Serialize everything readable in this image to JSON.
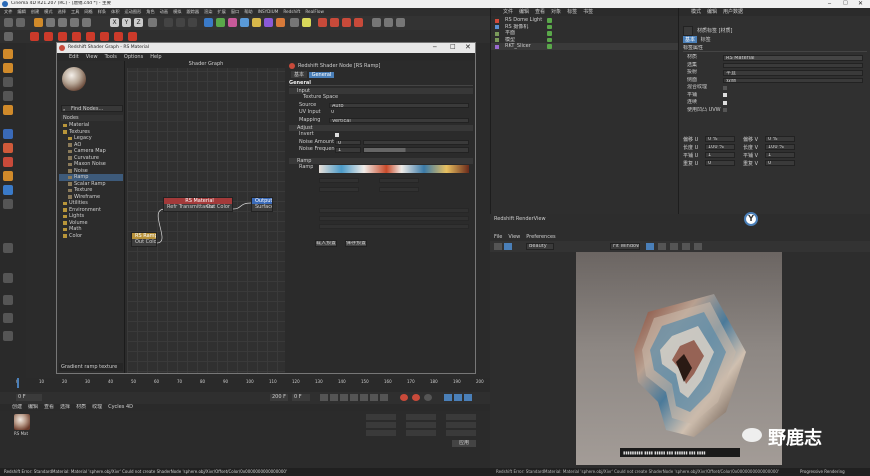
{
  "app_title": "Cinema 4D R21.207 (RC) - [唐锦.c4d *] - 主要",
  "main_menu": [
    "文件",
    "编辑",
    "创建",
    "模式",
    "选择",
    "工具",
    "网格",
    "样条",
    "体积",
    "运动图形",
    "角色",
    "动画",
    "模拟",
    "跟踪器",
    "渲染",
    "扩展",
    "窗口",
    "帮助",
    "INSYDIUM",
    "Redshift",
    "RealFlow"
  ],
  "shader_window": {
    "title": "Redshift Shader Graph - RS Material",
    "menu": [
      "Edit",
      "View",
      "Tools",
      "Options",
      "Help"
    ],
    "graph_title": "Shader Graph",
    "find_nodes": "Find Nodes...",
    "nodes_header": "Nodes",
    "tree": [
      "Material",
      "Textures",
      "Legacy",
      "AO",
      "Camera Map",
      "Curvature",
      "Maxon Noise",
      "Noise",
      "Ramp",
      "Scalar Ramp",
      "Texture",
      "Wireframe",
      "Utilities",
      "Environment",
      "Lights",
      "Volume",
      "Math",
      "Color"
    ],
    "description": "Gradient ramp texture",
    "nodes": {
      "rs_material": {
        "title": "RS Material",
        "in": "Refr Transmittance",
        "out": "Out Color"
      },
      "output": {
        "title": "Output",
        "in": "Surface"
      },
      "rs_ramp": {
        "title": "RS Ramp",
        "out": "Out Color"
      }
    },
    "props": {
      "node_title": "Redshift Shader Node [RS Ramp]",
      "tabs": [
        "基本",
        "General"
      ],
      "section_general": "General",
      "input_label": "Input",
      "texture_space": "Texture Space",
      "source_label": "Source",
      "source_value": "Auto",
      "uv_input_label": "UV Input",
      "uv_input_value": "0",
      "mapping_label": "Mapping",
      "mapping_value": "Vertical",
      "adjust_label": "Adjust",
      "invert_label": "Invert",
      "noise_amount_label": "Noise Amount",
      "noise_amount_value": "0",
      "noise_freq_label": "Noise Frequency",
      "noise_freq_value": "1",
      "ramp_section": "Ramp",
      "ramp_label": "Ramp",
      "btn_a": "载入预置...",
      "btn_b": "保存预置..."
    }
  },
  "object_manager": {
    "menu": [
      "文件",
      "编辑",
      "查看",
      "对象",
      "标签",
      "书签"
    ],
    "objects": [
      {
        "name": "RS Dome Light",
        "color": "#d04a3a"
      },
      {
        "name": "RS 摄像机",
        "color": "#5a8fd0"
      },
      {
        "name": "平面",
        "color": "#7a9a5a"
      },
      {
        "name": "模型",
        "color": "#7a9a5a"
      },
      {
        "name": "RKT_Slicer",
        "color": "#9a6ad0"
      }
    ]
  },
  "attr_manager": {
    "menu": [
      "模式",
      "编辑",
      "用户数据"
    ],
    "obj_label": "材质标签 [材质]",
    "tabs": [
      "基本",
      "标签",
      "坐标"
    ],
    "section": "标签属性",
    "rows": [
      {
        "label": "材质",
        "value": "RS Material"
      },
      {
        "label": "选集",
        "value": ""
      },
      {
        "label": "投射",
        "value": "平直"
      },
      {
        "label": "侧面",
        "value": "双面"
      },
      {
        "label": "混合纹理",
        "value": ""
      },
      {
        "label": "平铺",
        "value": ""
      },
      {
        "label": "连续",
        "value": ""
      },
      {
        "label": "使用凹凸 UVW",
        "value": ""
      }
    ],
    "offsets": [
      "偏移 U",
      "偏移 V",
      "长度 U",
      "长度 V",
      "平铺 U",
      "平铺 V",
      "重复 U",
      "重复 V"
    ],
    "offset_values": [
      "0 %",
      "0 %",
      "100 %",
      "100 %",
      "1",
      "1",
      "0",
      "0"
    ]
  },
  "render_view": {
    "title": "Redshift RenderView",
    "menu": [
      "File",
      "View",
      "Preferences"
    ],
    "mode": "Beauty",
    "zoom": "Fit Window",
    "watermark": "野鹿志",
    "status_right": "Progressive Rendering"
  },
  "timeline": {
    "ticks": [
      "0",
      "10",
      "20",
      "30",
      "40",
      "50",
      "60",
      "70",
      "80",
      "90",
      "100",
      "110",
      "120",
      "130",
      "140",
      "150",
      "160",
      "170",
      "180",
      "190",
      "200"
    ],
    "frame_start": "0 F",
    "frame_end": "200 F",
    "current": "0 F"
  },
  "material_manager": {
    "menu": [
      "创建",
      "编辑",
      "查看",
      "选择",
      "材质",
      "纹理",
      "Cycles 4D"
    ],
    "material_name": "RS Mat",
    "apply_label": "应用"
  },
  "status_bar": "Redshift Error: StandardMaterial: Material 'sphere.obj/Xivr' Could not create ShaderNode 'sphere.obj/Xivr/Offset/Color/0x0000000000000000'",
  "colors": {
    "accent": "#4a7fb8",
    "node_red": "#a33a3a",
    "node_blue": "#3a6ab8"
  }
}
